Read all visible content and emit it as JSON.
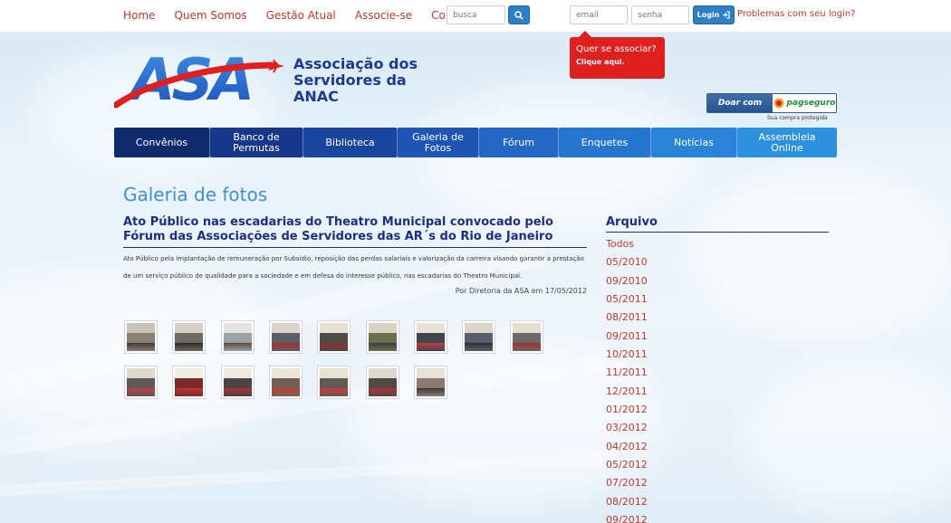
{
  "topbar": {
    "nav": [
      "Home",
      "Quem Somos",
      "Gestão Atual",
      "Associe-se",
      "Contato"
    ],
    "search_placeholder": "busca",
    "email_placeholder": "email",
    "senha_placeholder": "senha",
    "login_label": "Login",
    "login_problem": "Problemas com seu login?"
  },
  "associate_popup": {
    "question": "Quer se associar?",
    "cta": "Clique aqui."
  },
  "logo": {
    "text": "ASA",
    "org_line1": "Associação dos",
    "org_line2": "Servidores da",
    "org_line3": "ANAC"
  },
  "pagseguro": {
    "doar": "Doar com",
    "brand": "pagseguro",
    "sub": "Sua compra protegida"
  },
  "mainnav": [
    {
      "label": "Convênios",
      "color": "#0f2a6d"
    },
    {
      "label": "Banco de Permutas",
      "color": "#16378a"
    },
    {
      "label": "Biblioteca",
      "color": "#1b46a0"
    },
    {
      "label": "Galeria de Fotos",
      "color": "#1f56b5"
    },
    {
      "label": "Fórum",
      "color": "#2368c5"
    },
    {
      "label": "Enquetes",
      "color": "#2676cf"
    },
    {
      "label": "Notícias",
      "color": "#2983d8"
    },
    {
      "label": "Assembleia Online",
      "color": "#2e91e0"
    }
  ],
  "content": {
    "page_title": "Galeria de fotos",
    "article_title": "Ato Público nas escadarias do Theatro Municipal convocado pelo Fórum das Associações de Servidores das AR´s do Rio de Janeiro",
    "article_body": "Ato Público pela implantação de remuneração por Subsídio, reposição das perdas salariais e valorização da carreira visando garantir a prestação de um serviço público de qualidade para a sociedade e em defesa do interesse público, nas escadarias do Theatro Municipal.",
    "byline": "Por Diretoria da ASA em 17/05/2012",
    "photo_count": 16
  },
  "archive": {
    "title": "Arquivo",
    "items": [
      "Todos",
      "05/2010",
      "09/2010",
      "05/2011",
      "08/2011",
      "09/2011",
      "10/2011",
      "11/2011",
      "12/2011",
      "01/2012",
      "03/2012",
      "04/2012",
      "05/2012",
      "07/2012",
      "08/2012",
      "09/2012"
    ]
  },
  "colors": {
    "accent_red": "#c0392b",
    "navy": "#1d2f80",
    "title_blue": "#3d91d3",
    "popup_red": "#e0201e"
  }
}
